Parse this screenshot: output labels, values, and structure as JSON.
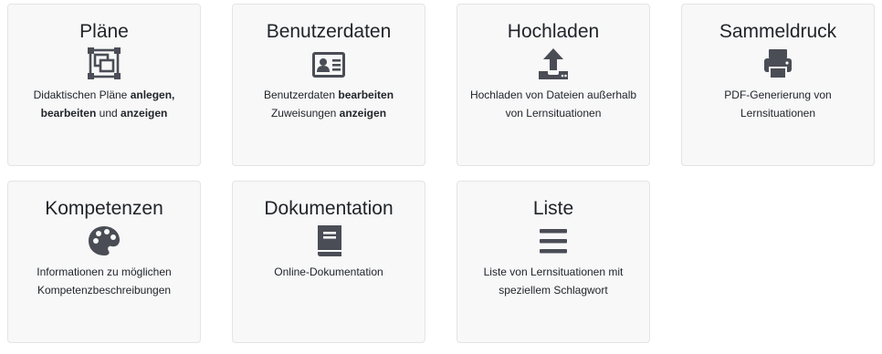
{
  "cards": [
    {
      "title": "Pläne",
      "icon": "object-ungroup-icon",
      "desc": [
        {
          "text": "Didaktischen Pläne ",
          "bold": false
        },
        {
          "text": "anlegen,",
          "bold": true
        },
        {
          "text": " ",
          "bold": false
        },
        {
          "text": "bearbeiten",
          "bold": true
        },
        {
          "text": " und ",
          "bold": false
        },
        {
          "text": "anzeigen",
          "bold": true
        }
      ]
    },
    {
      "title": "Benutzerdaten",
      "icon": "id-card-icon",
      "desc": [
        {
          "text": "Benutzerdaten ",
          "bold": false
        },
        {
          "text": "bearbeiten",
          "bold": true
        },
        {
          "text": " Zuweisungen ",
          "bold": false
        },
        {
          "text": "anzeigen",
          "bold": true
        }
      ]
    },
    {
      "title": "Hochladen",
      "icon": "upload-icon",
      "desc": [
        {
          "text": "Hochladen von Dateien außerhalb von Lernsituationen",
          "bold": false
        }
      ]
    },
    {
      "title": "Sammeldruck",
      "icon": "print-icon",
      "desc": [
        {
          "text": "PDF-Generierung von Lernsituationen",
          "bold": false
        }
      ]
    },
    {
      "title": "Kompetenzen",
      "icon": "palette-icon",
      "desc": [
        {
          "text": "Informationen zu möglichen Kompetenzbeschreibungen",
          "bold": false
        }
      ]
    },
    {
      "title": "Dokumentation",
      "icon": "book-icon",
      "desc": [
        {
          "text": "Online-Dokumentation",
          "bold": false
        }
      ]
    },
    {
      "title": "Liste",
      "icon": "list-icon",
      "desc": [
        {
          "text": "Liste von Lernsituationen mit speziellem Schlagwort",
          "bold": false
        }
      ]
    }
  ],
  "colors": {
    "icon": "#4a4d55",
    "card_bg": "#f8f8f9",
    "card_border": "#e3e4e6",
    "text": "#212529"
  }
}
